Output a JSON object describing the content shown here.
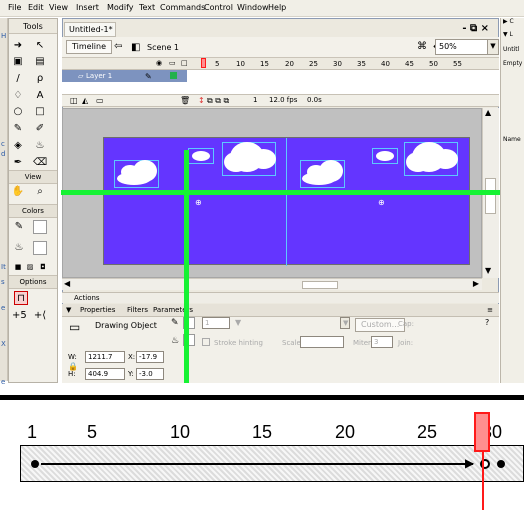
{
  "menu": {
    "items": [
      "File",
      "Edit",
      "View",
      "Insert",
      "Modify",
      "Text",
      "Commands",
      "Control",
      "Window",
      "Help"
    ]
  },
  "tools": {
    "title": "Tools",
    "view_label": "View",
    "colors_label": "Colors",
    "options_label": "Options"
  },
  "document": {
    "tab_label": "Untitled-1*",
    "timeline_button": "Timeline",
    "scene_label": "Scene 1",
    "zoom_value": "50%"
  },
  "timeline": {
    "layer_name": "Layer 1",
    "ruler_numbers": [
      "5",
      "10",
      "15",
      "20",
      "25",
      "30",
      "35",
      "40",
      "45",
      "50",
      "55"
    ],
    "frame_value": "1",
    "fps_value": "12.0 fps",
    "time_value": "0.0s"
  },
  "panels": {
    "actions_label": "Actions",
    "properties_tab": "Properties",
    "filters_tab": "Filters",
    "parameters_tab": "Parameters",
    "object_label": "Drawing Object",
    "stroke_hinting": "Stroke hinting",
    "scale_label": "Scale:",
    "custom_button": "Custom...",
    "cap_label": "Cap:",
    "miter_label": "Miter:",
    "miter_value": "3",
    "join_label": "Join:",
    "stroke_value": "1",
    "w_label": "W:",
    "w_value": "1211.7",
    "x_label": "X:",
    "x_value": "-17.9",
    "h_label": "H:",
    "h_value": "404.9",
    "y_label": "Y:",
    "y_value": "-3.0"
  },
  "right_panel": {
    "items": [
      "Untitl",
      "Empty",
      "Name"
    ]
  },
  "zoom_strip": {
    "numbers": [
      "1",
      "5",
      "10",
      "15",
      "20",
      "25",
      "30"
    ]
  },
  "colors": {
    "stage": "#6435ff",
    "guide_green": "#16f233",
    "playhead_red": "#ff1a1a"
  }
}
